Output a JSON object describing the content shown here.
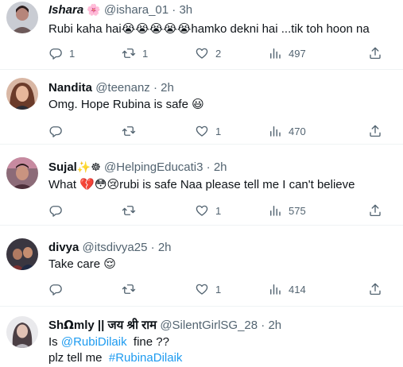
{
  "tweets": [
    {
      "name": "Ishara",
      "name_emoji": "🌸",
      "handle": "@ishara_01",
      "sep": "·",
      "time": "3h",
      "text": "Rubi kaha hai😭😭😭😭😭hamko dekni hai ...tik toh hoon na",
      "replies": "1",
      "retweets": "1",
      "likes": "2",
      "views": "497"
    },
    {
      "name": "Nandita",
      "handle": "@teenanz",
      "sep": "·",
      "time": "2h",
      "text": "Omg. Hope Rubina is safe 😃",
      "replies": "",
      "retweets": "",
      "likes": "1",
      "views": "470"
    },
    {
      "name": "Sujal",
      "name_emoji": "✨☸",
      "handle": "@HelpingEducati3",
      "sep": "·",
      "time": "2h",
      "text": "What 💔😳😢rubi is safe Naa please tell me I can't believe",
      "replies": "",
      "retweets": "",
      "likes": "1",
      "views": "575"
    },
    {
      "name": "divya",
      "handle": "@itsdivya25",
      "sep": "·",
      "time": "2h",
      "text": "Take care 😌",
      "replies": "",
      "retweets": "",
      "likes": "1",
      "views": "414"
    },
    {
      "name": "Sh𝝮mly || जय श्री राम",
      "handle": "@SilentGirlSG_28",
      "sep": "·",
      "time": "2h",
      "line1_prefix": "Is ",
      "line1_mention": "@RubiDilaik",
      "line1_suffix": "  fine ??",
      "line2_prefix": "plz tell me  ",
      "line2_hashtag": "#RubinaDilaik"
    }
  ],
  "colors": {
    "text": "#0f1419",
    "secondary": "#536471",
    "link": "#1d9bf0",
    "divider": "#eff3f4"
  },
  "icons": {
    "reply": "reply-icon",
    "retweet": "retweet-icon",
    "like": "heart-icon",
    "views": "views-icon",
    "share": "share-icon"
  }
}
